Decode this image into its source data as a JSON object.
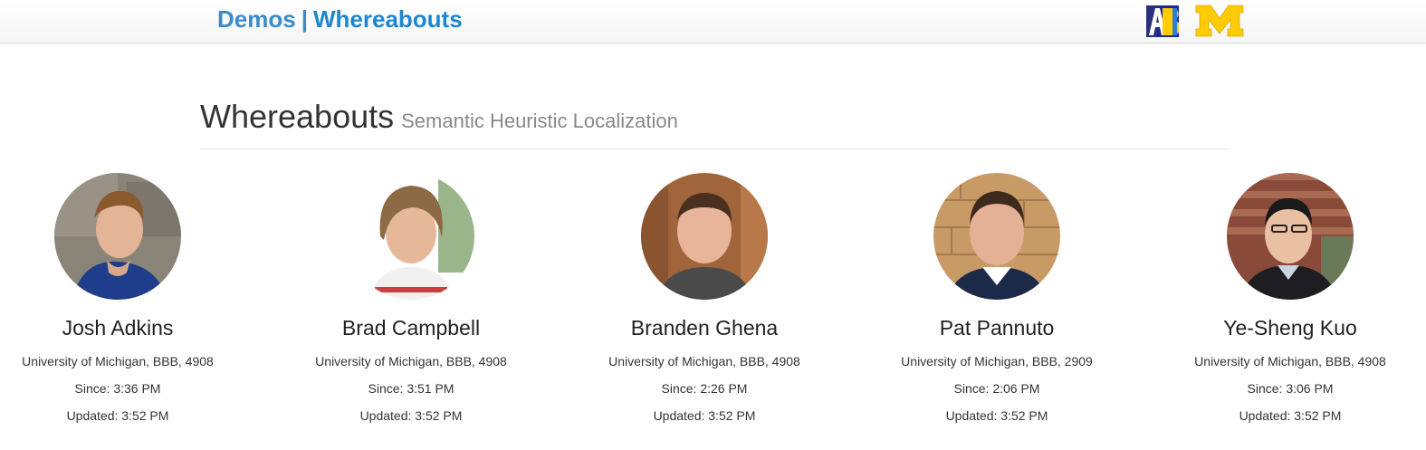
{
  "navbar": {
    "brand_demos": "Demos",
    "brand_separator": "|",
    "brand_app": "Whereabouts",
    "logo_left": "abi-logo",
    "logo_right": "block-m-logo"
  },
  "header": {
    "title": "Whereabouts",
    "subtitle": "Semantic Heuristic Localization"
  },
  "people": [
    {
      "name": "Josh Adkins",
      "location": "University of Michigan, BBB, 4908",
      "since": "Since: 3:36 PM",
      "updated": "Updated: 3:52 PM"
    },
    {
      "name": "Brad Campbell",
      "location": "University of Michigan, BBB, 4908",
      "since": "Since: 3:51 PM",
      "updated": "Updated: 3:52 PM"
    },
    {
      "name": "Branden Ghena",
      "location": "University of Michigan, BBB, 4908",
      "since": "Since: 2:26 PM",
      "updated": "Updated: 3:52 PM"
    },
    {
      "name": "Pat Pannuto",
      "location": "University of Michigan, BBB, 2909",
      "since": "Since: 2:06 PM",
      "updated": "Updated: 3:52 PM"
    },
    {
      "name": "Ye-Sheng Kuo",
      "location": "University of Michigan, BBB, 4908",
      "since": "Since: 3:06 PM",
      "updated": "Updated: 3:52 PM"
    }
  ],
  "colors": {
    "brand_blue": "#3a8cc9",
    "app_blue": "#1d87d0",
    "michigan_maize": "#ffcb05",
    "michigan_blue": "#00274c"
  }
}
